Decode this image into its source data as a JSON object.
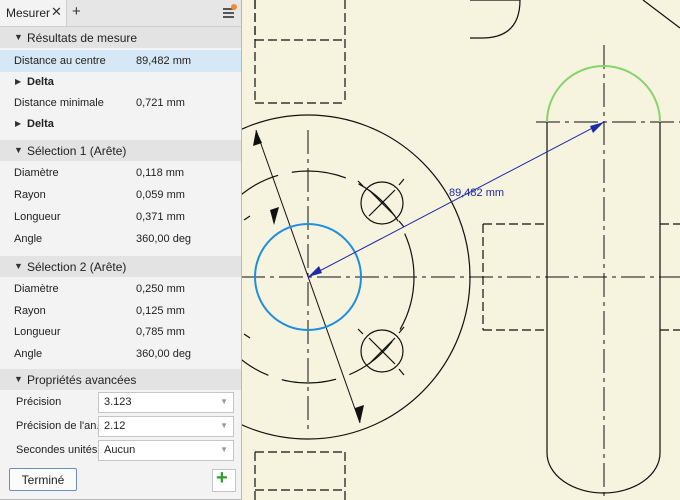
{
  "panel": {
    "tab_label": "Mesurer",
    "close_glyph": "✕",
    "add_tab_glyph": "+",
    "menu_icon": "hamburger-icon",
    "results": {
      "title": "Résultats de mesure",
      "center_distance_label": "Distance au centre",
      "center_distance_value": "89,482 mm",
      "delta_label": "Delta",
      "min_distance_label": "Distance minimale",
      "min_distance_value": "0,721 mm",
      "delta2_label": "Delta"
    },
    "selection1": {
      "title": "Sélection 1 (Arête)",
      "rows": [
        {
          "label": "Diamètre",
          "value": "0,118 mm"
        },
        {
          "label": "Rayon",
          "value": "0,059 mm"
        },
        {
          "label": "Longueur",
          "value": "0,371 mm"
        },
        {
          "label": "Angle",
          "value": "360,00 deg"
        }
      ]
    },
    "selection2": {
      "title": "Sélection 2 (Arête)",
      "rows": [
        {
          "label": "Diamètre",
          "value": "0,250 mm"
        },
        {
          "label": "Rayon",
          "value": "0,125 mm"
        },
        {
          "label": "Longueur",
          "value": "0,785 mm"
        },
        {
          "label": "Angle",
          "value": "360,00 deg"
        }
      ]
    },
    "advanced": {
      "title": "Propriétés avancées",
      "precision_label": "Précision",
      "precision_value": "3.123",
      "angle_precision_label": "Précision de l'an...",
      "angle_precision_value": "2.12",
      "secondary_units_label": "Secondes unités",
      "secondary_units_value": "Aucun"
    },
    "done_label": "Terminé",
    "add_glyph": "+"
  },
  "canvas": {
    "dimension_label": "89,482 mm"
  },
  "colors": {
    "canvas_bg": "#f6f3df",
    "geometry": "#111111",
    "selection_blue": "#1e8fe0",
    "highlight_green": "#86d46c",
    "dimension": "#1f2aa8"
  }
}
